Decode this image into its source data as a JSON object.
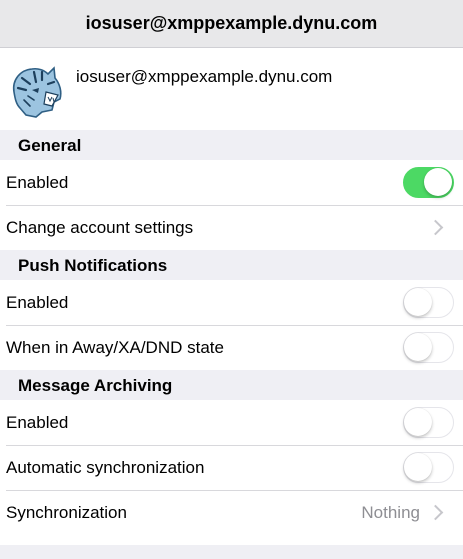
{
  "navbar": {
    "title": "iosuser@xmppexample.dynu.com"
  },
  "account": {
    "jid": "iosuser@xmppexample.dynu.com",
    "avatar_icon": "tiger-avatar-icon"
  },
  "sections": {
    "general": {
      "header": "General",
      "enabled_label": "Enabled",
      "enabled_on": true,
      "change_settings_label": "Change account settings"
    },
    "push": {
      "header": "Push Notifications",
      "enabled_label": "Enabled",
      "enabled_on": false,
      "away_label": "When in Away/XA/DND state",
      "away_on": false
    },
    "archiving": {
      "header": "Message Archiving",
      "enabled_label": "Enabled",
      "enabled_on": false,
      "autosync_label": "Automatic synchronization",
      "autosync_on": false,
      "sync_label": "Synchronization",
      "sync_value": "Nothing"
    }
  },
  "colors": {
    "toggle_on": "#4cd964",
    "background": "#efeff4",
    "secondary_text": "#8e8e93"
  }
}
